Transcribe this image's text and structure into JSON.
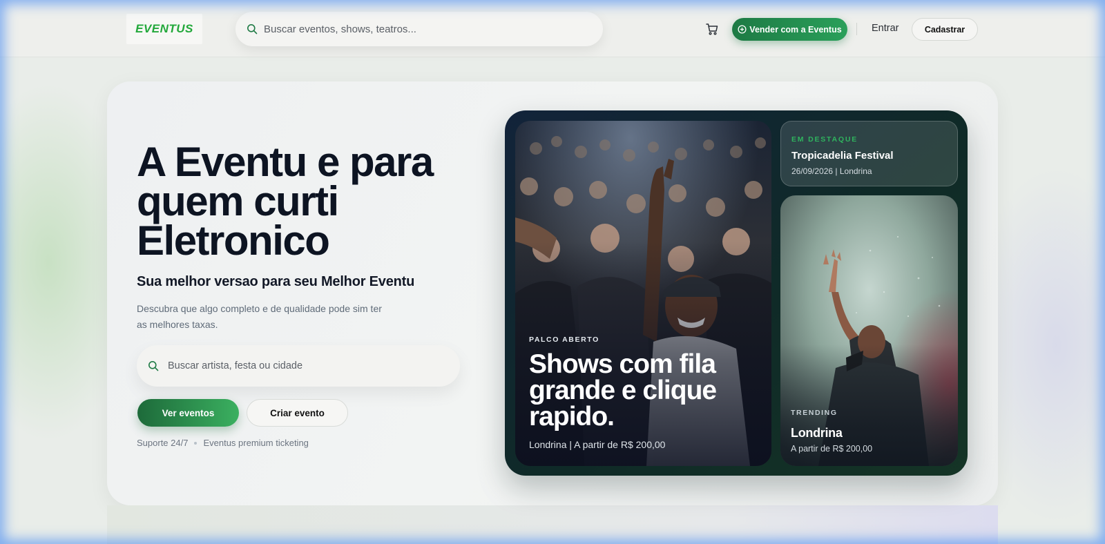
{
  "header": {
    "logo_text": "EVENTUS",
    "search_placeholder": "Buscar eventos, shows, teatros...",
    "sell_label": "Vender com a Eventus",
    "login_label": "Entrar",
    "signup_label": "Cadastrar"
  },
  "hero": {
    "title": "A Eventu e para quem curti Eletronico",
    "subtitle": "Sua melhor versao para seu Melhor Eventu",
    "description": "Descubra que algo completo e de qualidade pode sim ter as melhores taxas.",
    "search_placeholder": "Buscar artista, festa ou cidade",
    "primary_button": "Ver eventos",
    "secondary_button": "Criar evento",
    "meta": [
      "Suporte 24/7",
      "Eventus premium ticketing"
    ]
  },
  "showcase": {
    "feature": {
      "eyebrow": "PALCO ABERTO",
      "headline": "Shows com fila grande e clique rapido.",
      "meta": "Londrina | A partir de R$ 200,00"
    },
    "highlight": {
      "eyebrow": "EM DESTAQUE",
      "title": "Tropicadelia Festival",
      "meta": "26/09/2026 | Londrina"
    },
    "trending": {
      "eyebrow": "TRENDING",
      "title": "Londrina",
      "meta": "A partir de R$ 200,00"
    }
  },
  "colors": {
    "brand_green": "#22a83a",
    "button_green": "#1d7a44",
    "title": "#0d1422"
  },
  "icons": [
    "search-icon",
    "cart-icon",
    "plus-circle-icon"
  ]
}
